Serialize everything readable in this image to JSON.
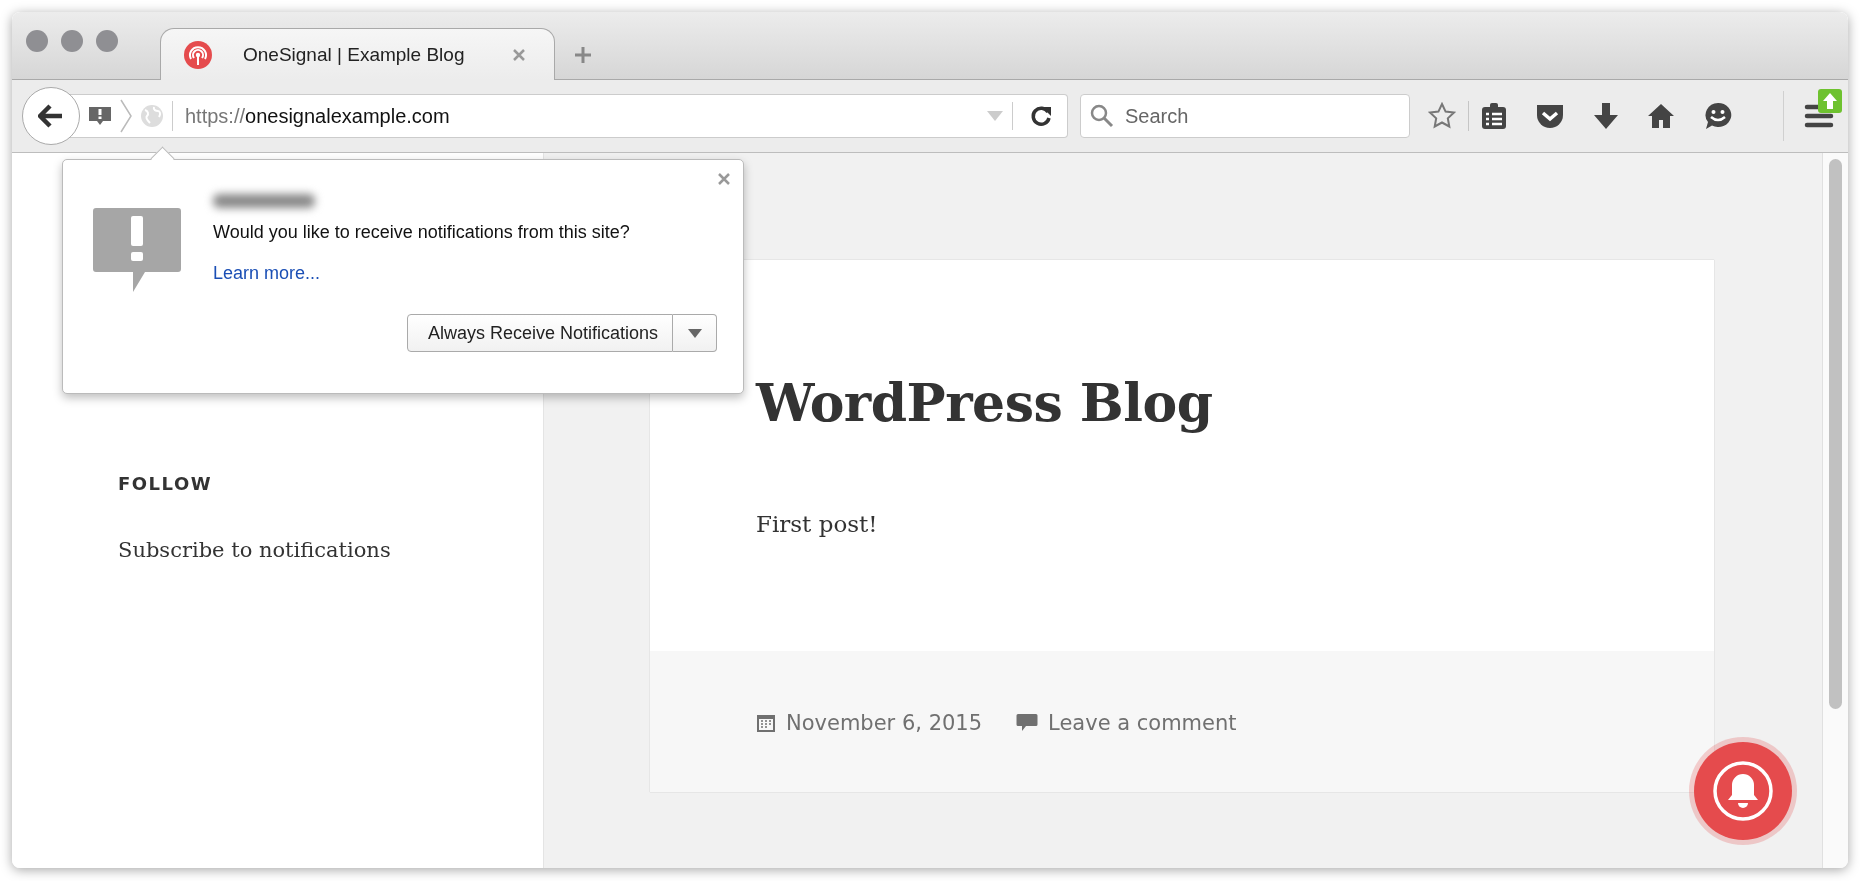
{
  "tabs": [
    {
      "title": "OneSignal | Example Blog",
      "selected": true
    }
  ],
  "toolbar": {
    "url_scheme": "https://",
    "url_host": "onesignalexample.com",
    "search": {
      "placeholder": "Search"
    }
  },
  "sidebar": {
    "widget_title": "FOLLOW",
    "widget_link": "Subscribe to notifications"
  },
  "post": {
    "title": "WordPress Blog",
    "body": "First post!",
    "date": "November 6, 2015",
    "comments_link": "Leave a comment"
  },
  "permission_popup": {
    "message": "Would you like to receive notifications from this site?",
    "link": "Learn more...",
    "button": "Always Receive Notifications"
  }
}
